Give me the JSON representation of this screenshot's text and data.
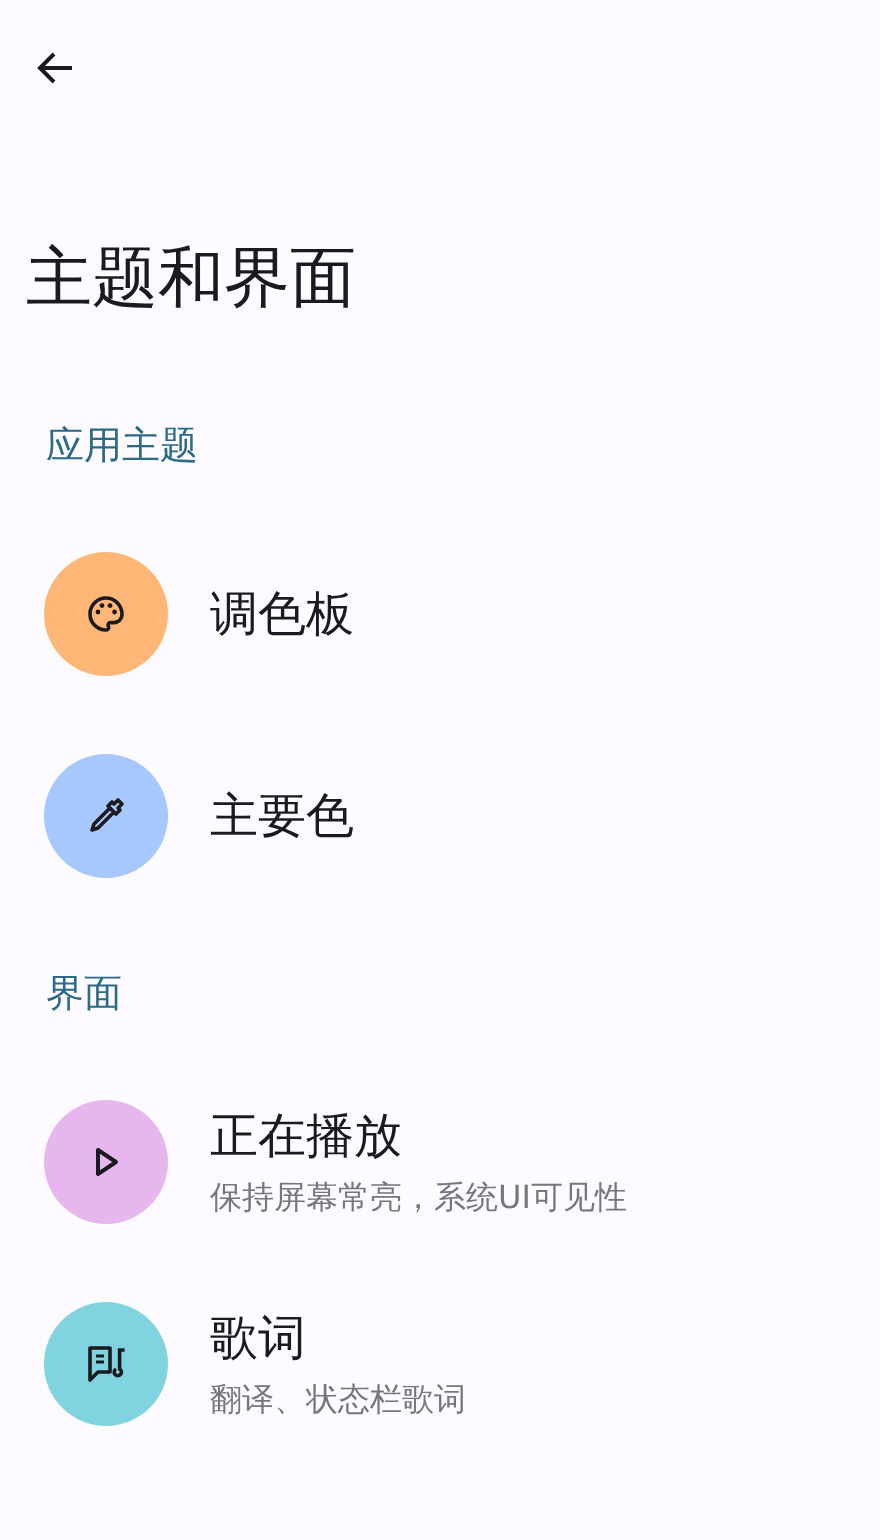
{
  "title": "主题和界面",
  "sections": [
    {
      "header": "应用主题",
      "items": [
        {
          "kind": "palette",
          "color": "#ffb677",
          "title": "调色板"
        },
        {
          "kind": "picker",
          "color": "#a6c8ff",
          "title": "主要色"
        }
      ]
    },
    {
      "header": "界面",
      "items": [
        {
          "kind": "play",
          "color": "#e8b6ee",
          "title": "正在播放",
          "subtitle": "保持屏幕常亮，系统UI可见性"
        },
        {
          "kind": "lyrics",
          "color": "#80d4e0",
          "title": "歌词",
          "subtitle": "翻译、状态栏歌词"
        }
      ]
    }
  ]
}
